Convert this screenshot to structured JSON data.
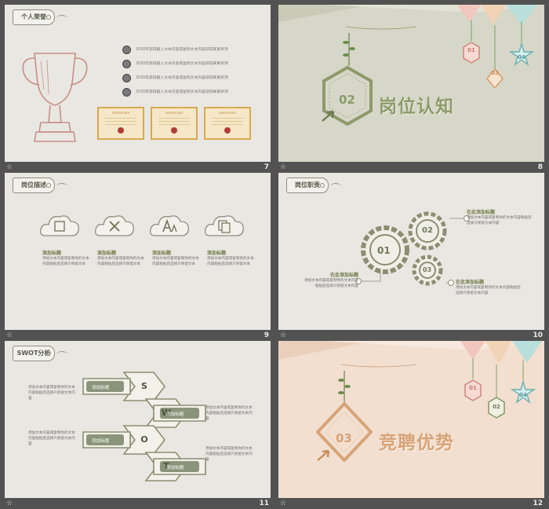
{
  "footer_star": "☆",
  "slides": {
    "s7": {
      "number": "7",
      "tag": "个人荣誉",
      "achievements": [
        "2030年获得输入文本内容或复制文本内容获得某某奖项",
        "2030年获得输入文本内容或复制文本内容获得某某奖项",
        "2030年获得输入文本内容或复制文本内容获得某某奖项",
        "2030年获得输入文本内容或复制文本内容获得某某奖项"
      ],
      "cert_title": "CERTIFICATE"
    },
    "s8": {
      "number": "8",
      "hex_number": "02",
      "title": "岗位认知",
      "ornaments": [
        "01",
        "03",
        "04"
      ]
    },
    "s9": {
      "number": "9",
      "tag": "岗位描述",
      "items": [
        {
          "title": "添加标题",
          "desc": "添加文本内容或复制你的文本内容粘贴后选择只保留文本"
        },
        {
          "title": "添加标题",
          "desc": "添加文本内容或复制你的文本内容粘贴后选择只保留文本"
        },
        {
          "title": "添加标题",
          "desc": "添加文本内容或复制你的文本内容粘贴后选择只保留文本"
        },
        {
          "title": "添加标题",
          "desc": "添加文本内容或复制你的文本内容粘贴后选择只保留文本"
        }
      ]
    },
    "s10": {
      "number": "10",
      "tag": "岗位职责",
      "gears": [
        "01",
        "02",
        "03"
      ],
      "callouts": [
        {
          "title": "在此添加标题",
          "desc": "添加文本内容或复制你的文本内容粘贴后选择只保留文本内容"
        },
        {
          "title": "在此添加标题",
          "desc": "添加文本内容或复制你的文本内容粘贴后选择只保留文本内容"
        },
        {
          "title": "在此添加标题",
          "desc": "添加文本内容或复制你的文本内容粘贴后选择只保留文本内容"
        }
      ]
    },
    "s11": {
      "number": "11",
      "tag": "SWOT分析",
      "letters": [
        "S",
        "W",
        "O",
        "T"
      ],
      "buttons": [
        "添加标题",
        "添加标题",
        "添加标题",
        "添加标题"
      ],
      "descs": [
        "添加文本内容或复制你的文本内容粘贴后选择只保留文本内容",
        "添加文本内容或复制你的文本内容粘贴后选择只保留文本内容",
        "添加文本内容或复制你的文本内容粘贴后选择只保留文本内容",
        "添加文本内容或复制你的文本内容粘贴后选择只保留文本内容"
      ]
    },
    "s12": {
      "number": "12",
      "hex_number": "03",
      "title": "竞聘优势",
      "ornaments": [
        "01",
        "02",
        "04"
      ]
    }
  },
  "colors": {
    "background": "#525252",
    "olive_slide": "#d6d7c8",
    "peach_slide": "#f2dfd0",
    "light_slide": "#e9e7e2",
    "sage_accent": "#8e9a6b",
    "peach_accent": "#d6a378"
  }
}
